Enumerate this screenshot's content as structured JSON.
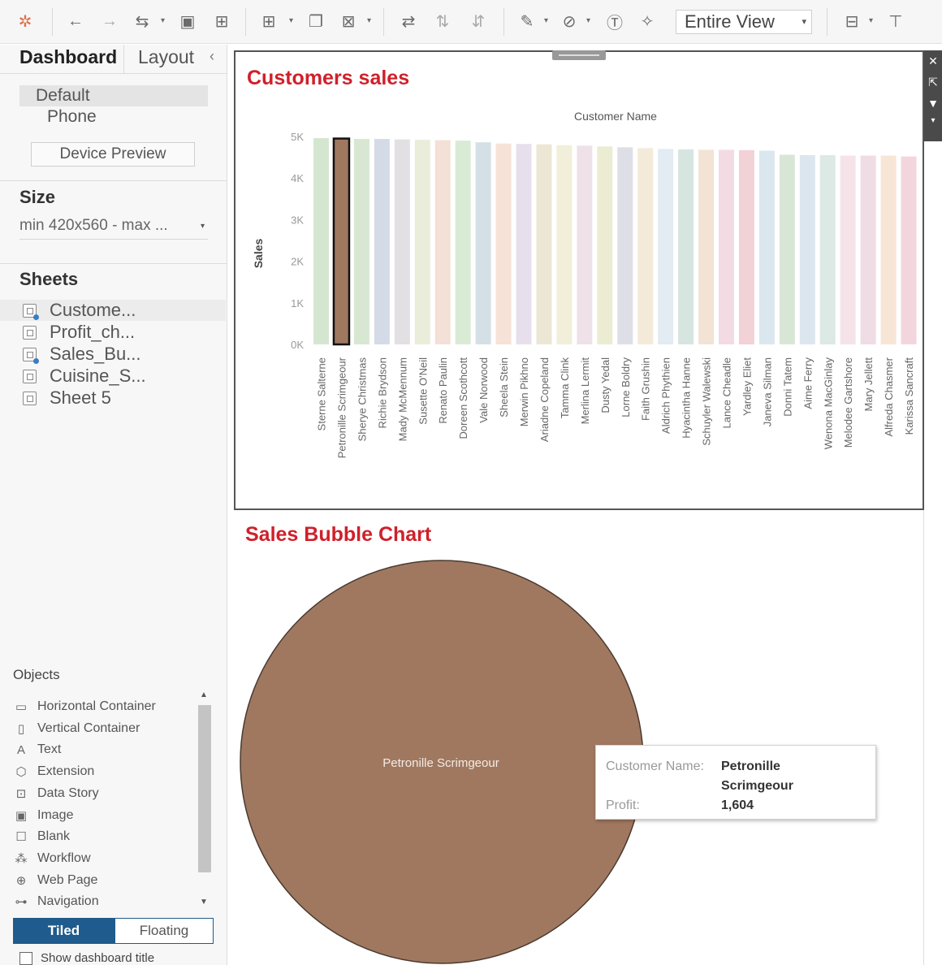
{
  "toolbar": {
    "view_select": "Entire View",
    "icons": [
      "tableau-logo-icon",
      "undo-icon",
      "redo-icon",
      "swap-icon",
      "save-icon",
      "new-datasource-icon",
      "new-worksheet-icon",
      "duplicate-icon",
      "clear-sheet-icon",
      "swap-axes-icon",
      "sort-ascending-icon",
      "sort-descending-icon",
      "highlight-icon",
      "group-icon",
      "label-icon",
      "pin-icon",
      "show-me-icon",
      "presentation-icon"
    ]
  },
  "left": {
    "tabs": {
      "dashboard": "Dashboard",
      "layout": "Layout"
    },
    "device": {
      "default": "Default",
      "phone": "Phone",
      "preview_button": "Device Preview"
    },
    "size": {
      "title": "Size",
      "value": "min 420x560 - max ..."
    },
    "sheets": {
      "title": "Sheets",
      "items": [
        {
          "label": "Custome...",
          "used": true
        },
        {
          "label": "Profit_ch...",
          "used": false
        },
        {
          "label": "Sales_Bu...",
          "used": true
        },
        {
          "label": "Cuisine_S...",
          "used": false
        },
        {
          "label": "Sheet 5",
          "used": false
        }
      ]
    },
    "objects": {
      "title": "Objects",
      "items": [
        {
          "label": "Horizontal Container",
          "icon": "horizontal-container-icon",
          "glyph": "▭"
        },
        {
          "label": "Vertical Container",
          "icon": "vertical-container-icon",
          "glyph": "▯"
        },
        {
          "label": "Text",
          "icon": "text-icon",
          "glyph": "A"
        },
        {
          "label": "Extension",
          "icon": "extension-icon",
          "glyph": "⬡"
        },
        {
          "label": "Data Story",
          "icon": "data-story-icon",
          "glyph": "⊡"
        },
        {
          "label": "Image",
          "icon": "image-icon",
          "glyph": "▣"
        },
        {
          "label": "Blank",
          "icon": "blank-icon",
          "glyph": "☐"
        },
        {
          "label": "Workflow",
          "icon": "workflow-icon",
          "glyph": "⁂"
        },
        {
          "label": "Web Page",
          "icon": "globe-icon",
          "glyph": "⊕"
        },
        {
          "label": "Navigation",
          "icon": "navigation-icon",
          "glyph": "⊶"
        }
      ]
    },
    "layout_mode": {
      "tiled": "Tiled",
      "floating": "Floating"
    },
    "show_title": "Show dashboard title"
  },
  "dashboard": {
    "chart1_title": "Customers sales",
    "chart2_title": "Sales Bubble Chart",
    "bubble_label": "Petronille Scrimgeour",
    "bubble_color": "#a07860",
    "tooltip": {
      "name_key": "Customer Name:",
      "name_line1": "Petronille",
      "name_line2": "Scrimgeour",
      "profit_key": "Profit:",
      "profit_val": "1,604"
    }
  },
  "chart_data": {
    "type": "bar",
    "title": "Customers sales",
    "top_label": "Customer Name",
    "ylabel": "Sales",
    "ylim": [
      0,
      5000
    ],
    "yticks": [
      "0K",
      "1K",
      "2K",
      "3K",
      "4K",
      "5K"
    ],
    "categories": [
      "Sterne Salterne",
      "Petronille Scrimgeour",
      "Sherye Christmas",
      "Richie Brydson",
      "Mady McMennum",
      "Susette O'Neil",
      "Renato Paulin",
      "Doreen Scothcott",
      "Vale Norwood",
      "Sheela Stein",
      "Merwin Pikhno",
      "Ariadne Copeland",
      "Tamma Clink",
      "Merlina Lermit",
      "Dusty Yedal",
      "Lorne Boldry",
      "Faith Grushin",
      "Aldrich Phythien",
      "Hyacintha Hanne",
      "Schuyler Walewski",
      "Lance Cheadle",
      "Yardley Eliet",
      "Janeva Silman",
      "Donni Tatem",
      "Aime Ferry",
      "Wenona MacGinlay",
      "Melodee Gartshore",
      "Mary Jellett",
      "Alfreda Chasmer",
      "Karissa Sancraft"
    ],
    "values": [
      4960,
      4950,
      4940,
      4940,
      4930,
      4920,
      4910,
      4900,
      4860,
      4830,
      4820,
      4810,
      4790,
      4780,
      4760,
      4740,
      4720,
      4700,
      4690,
      4680,
      4680,
      4670,
      4660,
      4560,
      4550,
      4550,
      4540,
      4540,
      4540,
      4520
    ],
    "highlighted": "Petronille Scrimgeour",
    "highlight_color": "#a07860",
    "colors": [
      "#d5e6d0",
      "#a07860",
      "#d7e7d2",
      "#d4dbe7",
      "#e3e0e3",
      "#e9edda",
      "#f3e0d6",
      "#d9ebd5",
      "#d4e0e5",
      "#f6e2d7",
      "#e7e0ec",
      "#ece6d4",
      "#f1eeda",
      "#efe1e8",
      "#ebecd2",
      "#dedfe6",
      "#f4ead9",
      "#e3ebf3",
      "#d7e5e1",
      "#f2e3d5",
      "#f3dbe3",
      "#f2d1d7",
      "#dbe7ef",
      "#d8e6d6",
      "#dce6ef",
      "#dce9e4",
      "#f6e3ea",
      "#f0dce4",
      "#f7e6d6",
      "#f3d6dd"
    ]
  }
}
